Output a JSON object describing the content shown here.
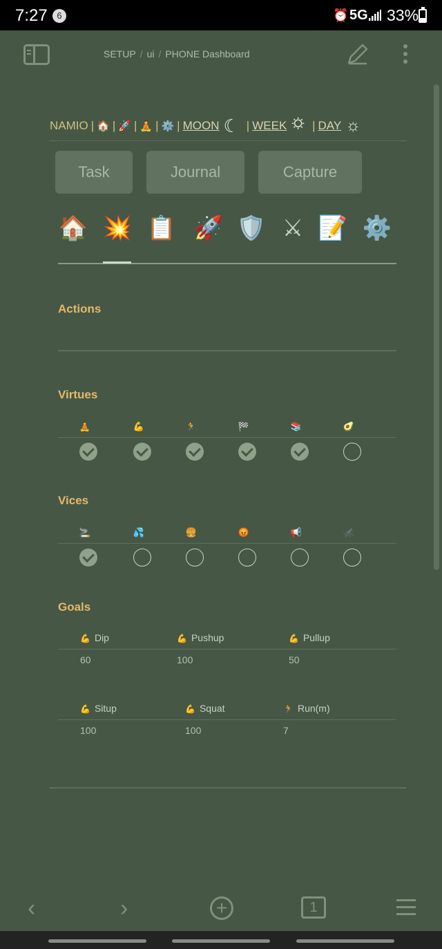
{
  "status_bar": {
    "time": "7:27",
    "notification_count": "6",
    "network": "5G",
    "battery_text": "33%",
    "battery_level": 0.33
  },
  "top_nav": {
    "breadcrumb": [
      "SETUP",
      "ui",
      "PHONE Dashboard"
    ],
    "breadcrumb_separator": "/"
  },
  "link_row": {
    "brand": "NAMIO",
    "pipe": "|",
    "emoji_links": [
      "🏠",
      "🚀",
      "🧘",
      "⚙️"
    ],
    "moon_label": "MOON",
    "moon_icon": "☾",
    "week_label": "WEEK",
    "week_icon": "🌣",
    "day_label": "DAY",
    "day_icon": "☼"
  },
  "buttons": {
    "task": "Task",
    "journal": "Journal",
    "capture": "Capture"
  },
  "tabs": [
    {
      "icon": "🏠",
      "name": "home"
    },
    {
      "icon": "💥",
      "name": "actions"
    },
    {
      "icon": "📋",
      "name": "clipboard"
    },
    {
      "icon": "🚀",
      "name": "rocket"
    },
    {
      "icon": "🛡️",
      "name": "shield"
    },
    {
      "icon": "⚔",
      "name": "swords"
    },
    {
      "icon": "📝",
      "name": "notes"
    },
    {
      "icon": "⚙️",
      "name": "settings"
    }
  ],
  "active_tab": "actions",
  "sections": {
    "actions": {
      "title": "Actions"
    },
    "virtues": {
      "title": "Virtues",
      "icons": [
        "🧘",
        "💪",
        "🏃",
        "🏁",
        "📚",
        "🥑"
      ],
      "checked": [
        true,
        true,
        true,
        true,
        true,
        false
      ]
    },
    "vices": {
      "title": "Vices",
      "icons": [
        "🚬",
        "💦",
        "🍔",
        "😡",
        "📢",
        "🦟"
      ],
      "checked": [
        true,
        false,
        false,
        false,
        false,
        false
      ]
    },
    "goals": {
      "title": "Goals",
      "rows": [
        {
          "headers": [
            {
              "emoji": "💪",
              "label": "Dip"
            },
            {
              "emoji": "💪",
              "label": "Pushup"
            },
            {
              "emoji": "💪",
              "label": "Pullup"
            }
          ],
          "values": [
            "60",
            "100",
            "50"
          ]
        },
        {
          "headers": [
            {
              "emoji": "💪",
              "label": "Situp"
            },
            {
              "emoji": "💪",
              "label": "Squat"
            },
            {
              "emoji": "🏃",
              "label": "Run(m)"
            }
          ],
          "values": [
            "100",
            "100",
            "7"
          ]
        }
      ]
    }
  },
  "bottom_bar": {
    "back_icon": "‹",
    "forward_icon": "›",
    "add_icon": "+",
    "tab_count": "1"
  }
}
